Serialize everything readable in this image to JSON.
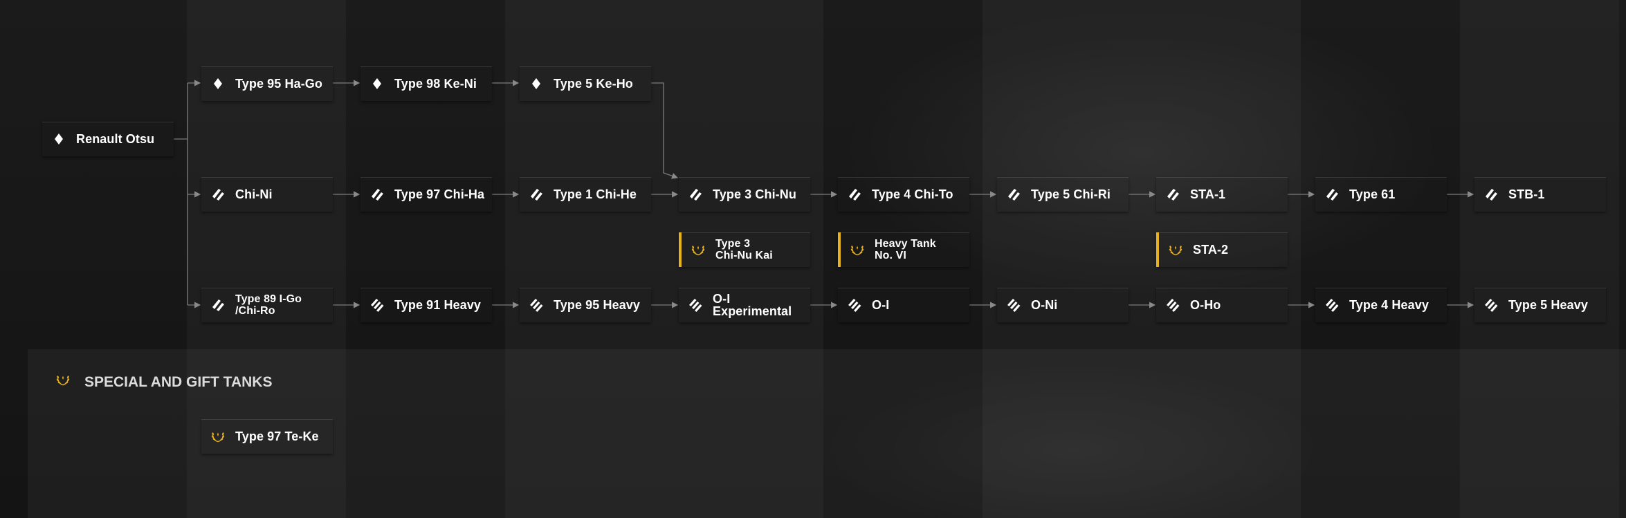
{
  "colors": {
    "green": "#557f54",
    "blue": "#55638a",
    "gray": "#464646",
    "premium_gold": "#e6b21f"
  },
  "special_section": {
    "title": "SPECIAL AND GIFT TANKS",
    "icon": "laurel-icon"
  },
  "nodes": [
    {
      "id": "n1",
      "label": "Renault Otsu",
      "color": "green",
      "icon": "diamond-icon"
    },
    {
      "id": "n2",
      "label": "Type 95 Ha-Go",
      "color": "green",
      "icon": "diamond-icon"
    },
    {
      "id": "n3",
      "label": "Type 98 Ke-Ni",
      "color": "green",
      "icon": "diamond-icon"
    },
    {
      "id": "n4",
      "label": "Type 5 Ke-Ho",
      "color": "green",
      "icon": "diamond-icon"
    },
    {
      "id": "n5",
      "label": "Chi-Ni",
      "color": "blue",
      "icon": "medium-tank-icon"
    },
    {
      "id": "n6",
      "label": "Type 97 Chi-Ha",
      "color": "blue",
      "icon": "medium-tank-icon"
    },
    {
      "id": "n7",
      "label": "Type 1 Chi-He",
      "color": "blue",
      "icon": "medium-tank-icon"
    },
    {
      "id": "n8",
      "label": "Type 3 Chi-Nu",
      "color": "blue",
      "icon": "medium-tank-icon"
    },
    {
      "id": "n9",
      "label": "Type 4 Chi-To",
      "color": "blue",
      "icon": "medium-tank-icon"
    },
    {
      "id": "n10",
      "label": "Type 5 Chi-Ri",
      "color": "blue",
      "icon": "medium-tank-icon"
    },
    {
      "id": "n11",
      "label": "STA-1",
      "color": "blue",
      "icon": "medium-tank-icon"
    },
    {
      "id": "n12",
      "label": "Type 61",
      "color": "blue",
      "icon": "medium-tank-icon"
    },
    {
      "id": "n13",
      "label": "STB-1",
      "color": "blue",
      "icon": "medium-tank-icon"
    },
    {
      "id": "n14",
      "label": "Type 3\nChi-Nu Kai",
      "color": "blue",
      "icon": "laurel-icon",
      "premium": true
    },
    {
      "id": "n15",
      "label": "Heavy Tank\nNo. VI",
      "color": "gray",
      "icon": "laurel-icon",
      "premium": true
    },
    {
      "id": "n16",
      "label": "STA-2",
      "color": "blue",
      "icon": "laurel-icon",
      "premium": true
    },
    {
      "id": "n17",
      "label": "Type 89 I-Go\n/Chi-Ro",
      "color": "blue",
      "icon": "medium-tank-icon"
    },
    {
      "id": "n18",
      "label": "Type 91 Heavy",
      "color": "gray",
      "icon": "heavy-tank-icon"
    },
    {
      "id": "n19",
      "label": "Type 95 Heavy",
      "color": "gray",
      "icon": "heavy-tank-icon"
    },
    {
      "id": "n20",
      "label": "O-I Experimental",
      "color": "gray",
      "icon": "heavy-tank-icon"
    },
    {
      "id": "n21",
      "label": "O-I",
      "color": "gray",
      "icon": "heavy-tank-icon"
    },
    {
      "id": "n22",
      "label": "O-Ni",
      "color": "gray",
      "icon": "heavy-tank-icon"
    },
    {
      "id": "n23",
      "label": "O-Ho",
      "color": "gray",
      "icon": "heavy-tank-icon"
    },
    {
      "id": "n24",
      "label": "Type 4 Heavy",
      "color": "gray",
      "icon": "heavy-tank-icon"
    },
    {
      "id": "n25",
      "label": "Type 5 Heavy",
      "color": "gray",
      "icon": "heavy-tank-icon"
    },
    {
      "id": "n26",
      "label": "Type 97 Te-Ke",
      "color": "green",
      "icon": "laurel-icon"
    }
  ]
}
